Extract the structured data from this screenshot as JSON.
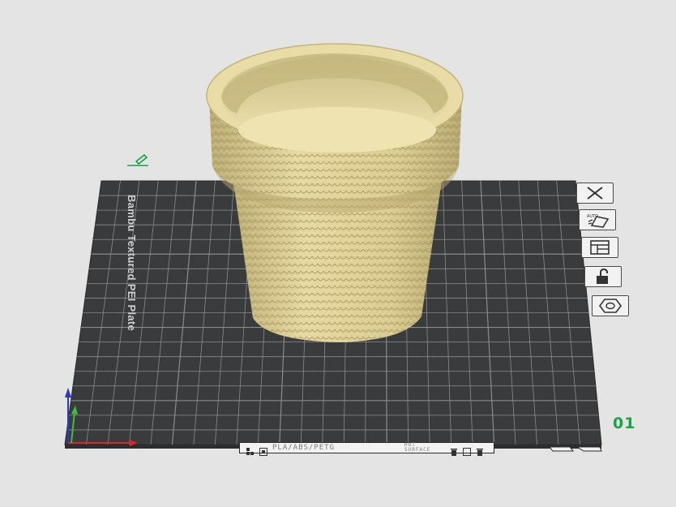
{
  "viewport": {
    "plate_name": "Bambu Textured PEI Plate",
    "plate_number": "01",
    "bed_label_text": "PLA/ABS/PETG",
    "bed_surface_text": [
      "HOT",
      "SURFACE"
    ]
  },
  "sidebar": {
    "buttons": [
      {
        "name": "remove-plate-button",
        "icon": "close-icon"
      },
      {
        "name": "auto-arrange-button",
        "icon": "auto-arrange-icon",
        "label": "AUTO"
      },
      {
        "name": "plate-settings-button",
        "icon": "layout-icon"
      },
      {
        "name": "lock-plate-button",
        "icon": "unlock-icon"
      },
      {
        "name": "plate-type-button",
        "icon": "hexagon-nut-icon"
      }
    ]
  },
  "colors": {
    "background": "#e4e4e4",
    "bed": "#3a3b3d",
    "bed_grid": "#8a8b8d",
    "model": "#e2d39b",
    "accent_green": "#17a443",
    "axis_x": "#d9262a",
    "axis_y": "#3fbf3a",
    "axis_z": "#2a37c9"
  }
}
